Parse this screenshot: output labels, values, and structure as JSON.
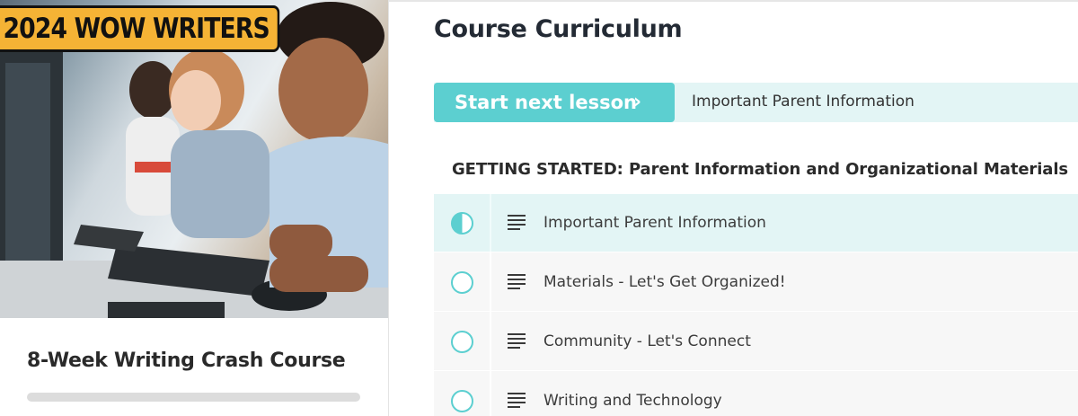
{
  "course": {
    "badge_text": "2024 WOW WRITERS",
    "title": "8-Week Writing Crash Course",
    "progress_percent": 0
  },
  "curriculum": {
    "heading": "Course Curriculum",
    "start_next_label": "Start next lesson",
    "chevron_glyph": "›",
    "next_lesson_title": "Important Parent Information",
    "section_title": "GETTING STARTED: Parent Information and Organizational Materials",
    "lessons": [
      {
        "title": "Important Parent Information",
        "status": "in-progress",
        "icon": "text-lines-icon"
      },
      {
        "title": "Materials - Let's Get Organized!",
        "status": "not-started",
        "icon": "text-lines-icon"
      },
      {
        "title": "Community - Let's Connect",
        "status": "not-started",
        "icon": "text-lines-icon"
      },
      {
        "title": "Writing and Technology",
        "status": "not-started",
        "icon": "text-lines-icon"
      }
    ]
  },
  "colors": {
    "accent": "#5ccfd0",
    "accent_light": "#e3f5f5",
    "badge": "#f5b335"
  }
}
